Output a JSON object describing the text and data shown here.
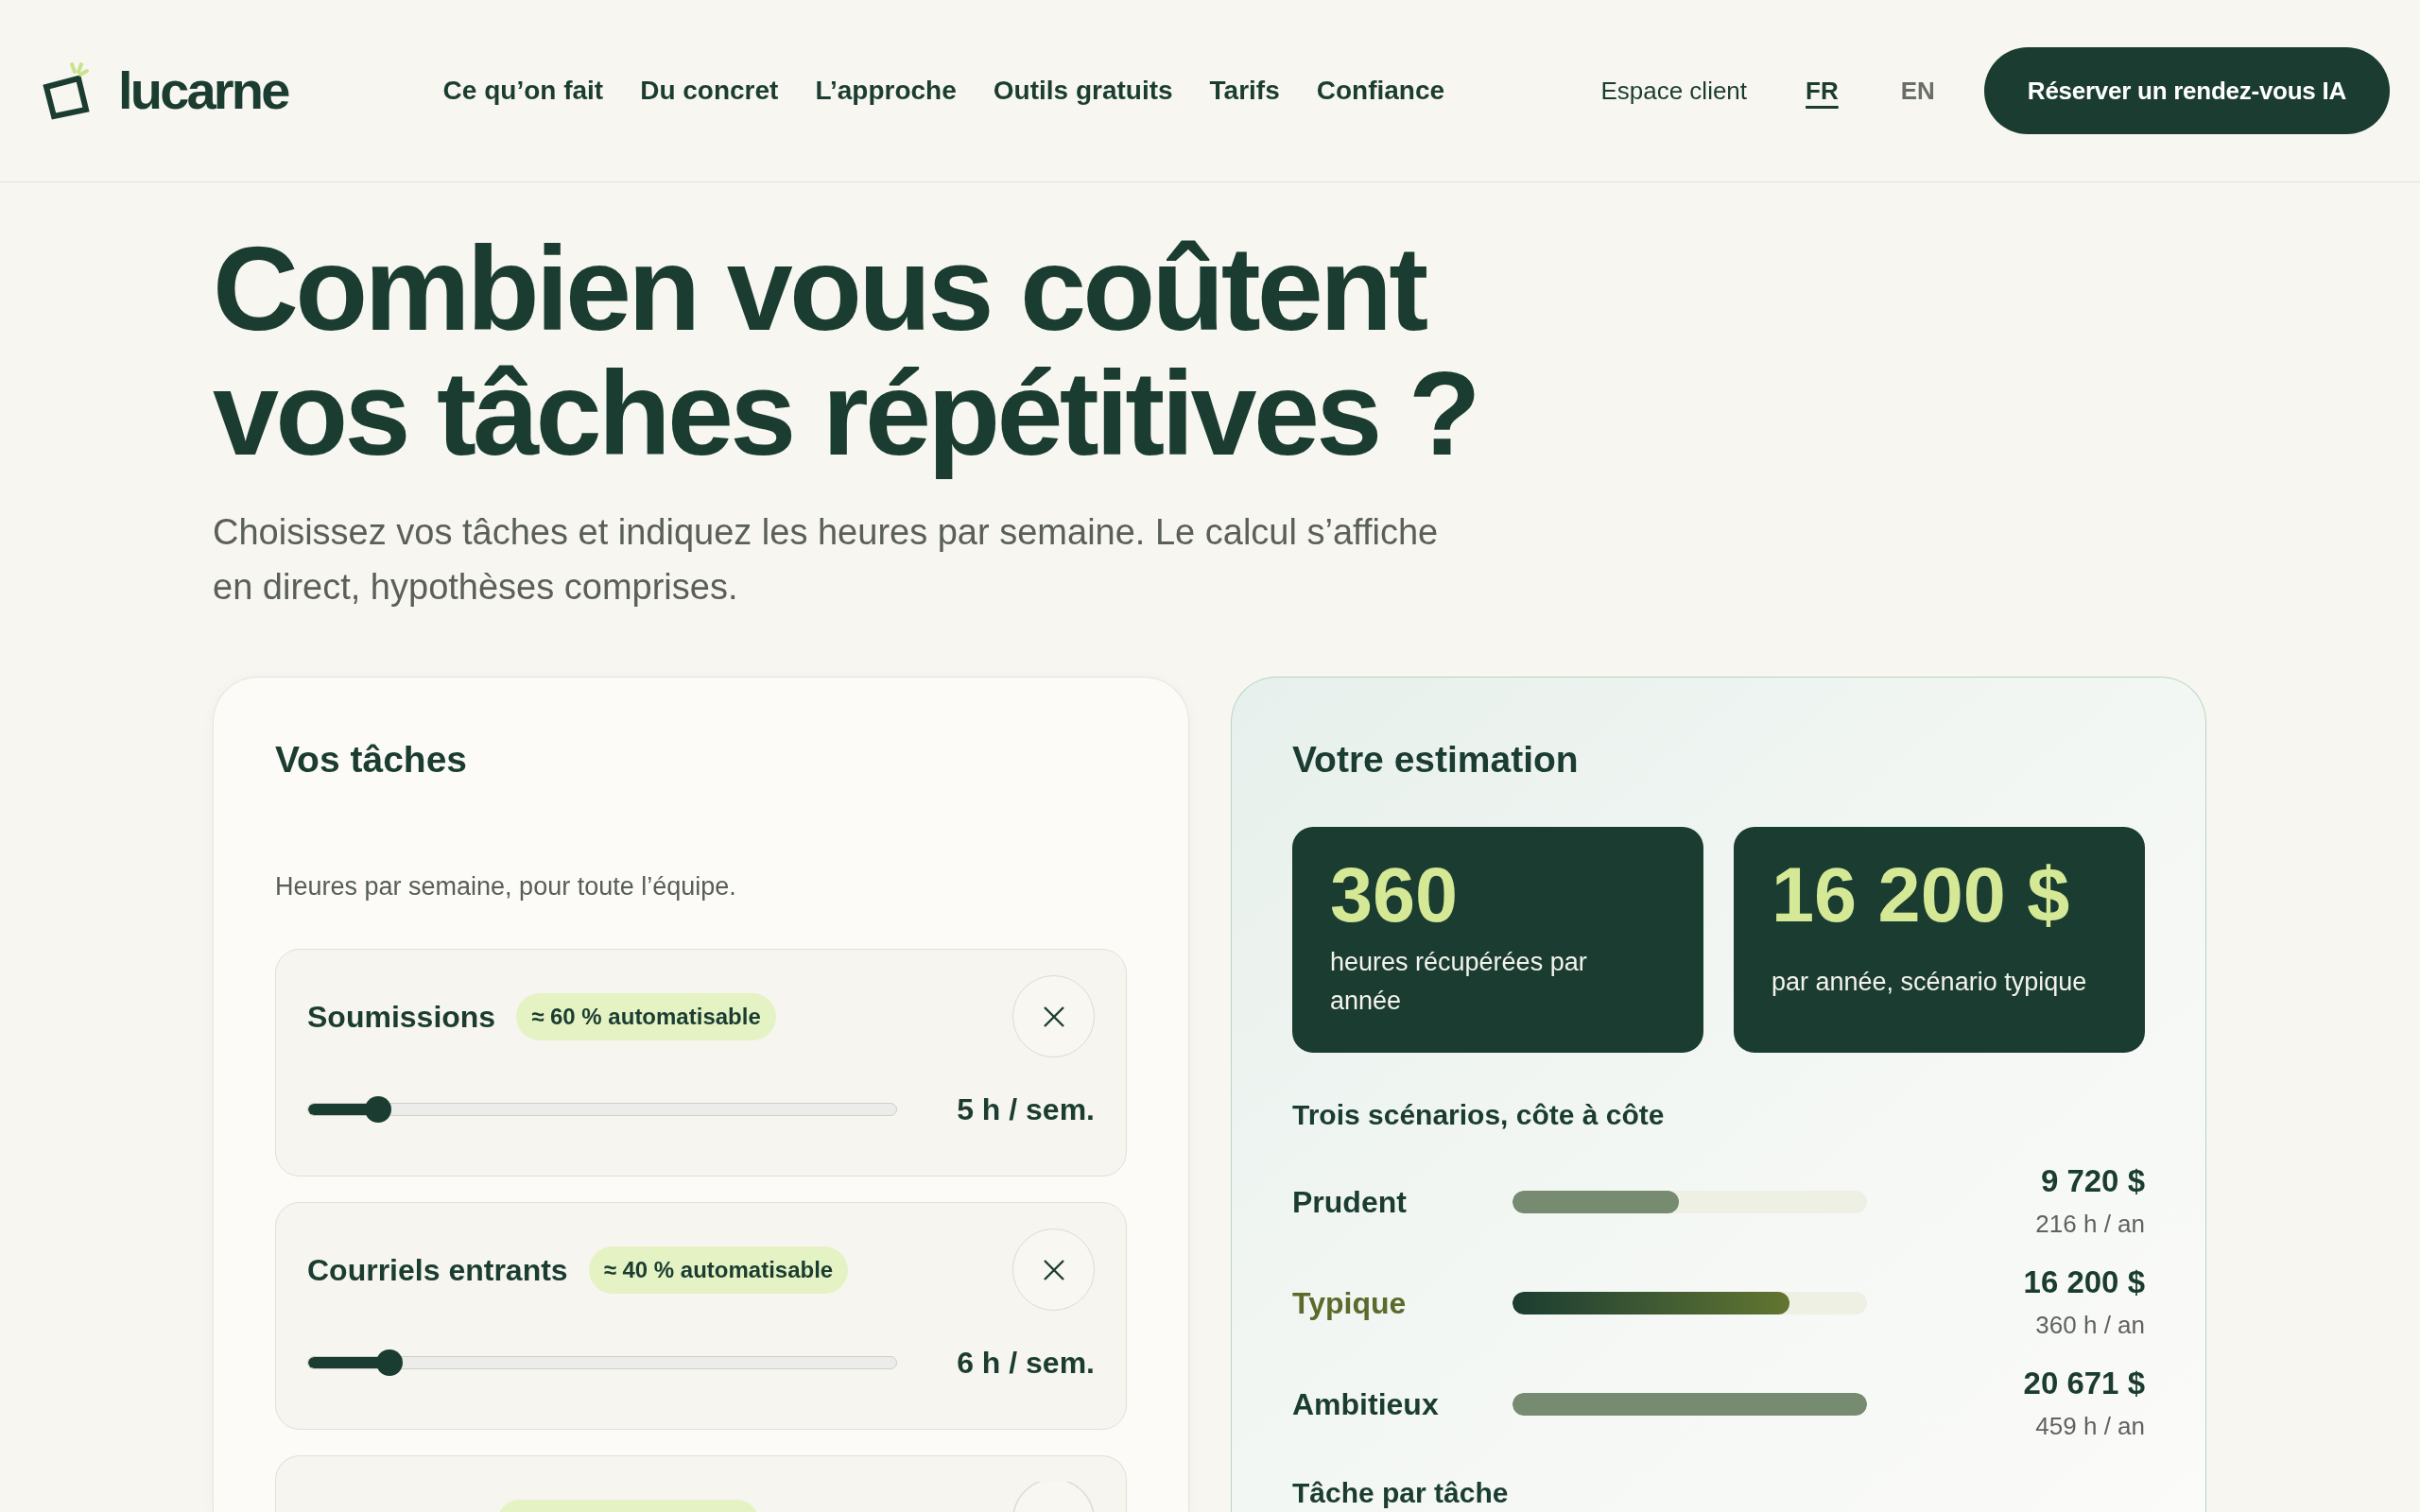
{
  "header": {
    "logo": "lucarne",
    "nav": [
      "Ce qu’on fait",
      "Du concret",
      "L’approche",
      "Outils gratuits",
      "Tarifs",
      "Confiance"
    ],
    "client_link": "Espace client",
    "languages": [
      {
        "label": "FR",
        "selected": true
      },
      {
        "label": "EN",
        "selected": false
      }
    ],
    "cta": "Réserver un rendez-vous IA"
  },
  "hero": {
    "title": "Combien vous coûtent vos tâches répétitives ?",
    "subtitle": "Choisissez vos tâches et indiquez les heures par semaine. Le calcul s’affiche en direct, hypothèses comprises."
  },
  "tasks_panel": {
    "title": "Vos tâches",
    "hint": "Heures par semaine, pour toute l’équipe.",
    "tasks": [
      {
        "name": "Soumissions",
        "badge": "≈ 60 % automatisable",
        "level": 0.12,
        "reading": "5 h / sem."
      },
      {
        "name": "Courriels entrants",
        "badge": "≈ 40 % automatisable",
        "level": 0.14,
        "reading": "6 h / sem."
      }
    ]
  },
  "estimate_panel": {
    "title": "Votre estimation",
    "stats": [
      {
        "value": "360",
        "label": "heures récupérées par année"
      },
      {
        "value": "16 200 $",
        "label": "par année, scénario typique"
      }
    ],
    "scenarios_title": "Trois scénarios, côte à côte",
    "scenarios": [
      {
        "name": "Prudent",
        "selected": false,
        "level": 0.47,
        "amount": "9 720 $",
        "hours": "216 h / an"
      },
      {
        "name": "Typique",
        "selected": true,
        "level": 0.78,
        "amount": "16 200 $",
        "hours": "360 h / an"
      },
      {
        "name": "Ambitieux",
        "selected": false,
        "level": 1,
        "amount": "20 671 $",
        "hours": "459 h / an"
      }
    ],
    "breakdown_title": "Tâche par tâche"
  }
}
